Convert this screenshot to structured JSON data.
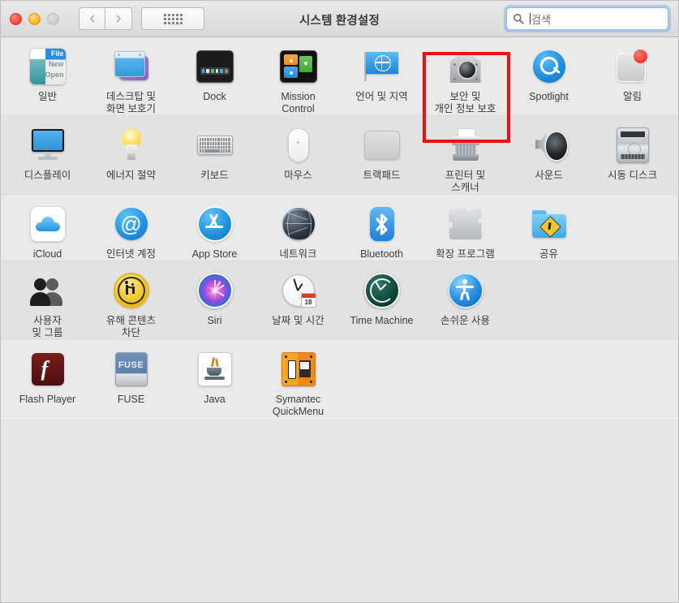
{
  "window": {
    "title": "시스템 환경설정",
    "traffic_lights": [
      "close",
      "minimize",
      "zoom"
    ],
    "nav_back": "back-chevron",
    "nav_forward": "forward-chevron",
    "show_all": "grid-icon"
  },
  "search": {
    "placeholder": "검색",
    "value": "검색",
    "icon": "search-icon"
  },
  "highlight": {
    "target": "보안 및\n개인 정보 보호",
    "color": "#ee1111"
  },
  "rows": [
    {
      "band": "band-a",
      "items": [
        {
          "label": "일반",
          "icon": "general-icon"
        },
        {
          "label": "데스크탑 및\n화면 보호기",
          "icon": "desktop-screensaver-icon"
        },
        {
          "label": "Dock",
          "icon": "dock-icon"
        },
        {
          "label": "Mission\nControl",
          "icon": "mission-control-icon"
        },
        {
          "label": "언어 및 지역",
          "icon": "language-region-icon"
        },
        {
          "label": "보안 및\n개인 정보 보호",
          "icon": "security-privacy-icon"
        },
        {
          "label": "Spotlight",
          "icon": "spotlight-icon"
        },
        {
          "label": "알림",
          "icon": "notifications-icon"
        }
      ]
    },
    {
      "band": "band-b",
      "items": [
        {
          "label": "디스플레이",
          "icon": "displays-icon"
        },
        {
          "label": "에너지 절약",
          "icon": "energy-saver-icon"
        },
        {
          "label": "키보드",
          "icon": "keyboard-icon"
        },
        {
          "label": "마우스",
          "icon": "mouse-icon"
        },
        {
          "label": "트랙패드",
          "icon": "trackpad-icon"
        },
        {
          "label": "프린터 및\n스캐너",
          "icon": "printers-scanners-icon"
        },
        {
          "label": "사운드",
          "icon": "sound-icon"
        },
        {
          "label": "시동 디스크",
          "icon": "startup-disk-icon"
        }
      ]
    },
    {
      "band": "band-a",
      "items": [
        {
          "label": "iCloud",
          "icon": "icloud-icon"
        },
        {
          "label": "인터넷 계정",
          "icon": "internet-accounts-icon"
        },
        {
          "label": "App Store",
          "icon": "app-store-icon"
        },
        {
          "label": "네트워크",
          "icon": "network-icon"
        },
        {
          "label": "Bluetooth",
          "icon": "bluetooth-icon"
        },
        {
          "label": "확장 프로그램",
          "icon": "extensions-icon"
        },
        {
          "label": "공유",
          "icon": "sharing-icon"
        }
      ]
    },
    {
      "band": "band-b",
      "items": [
        {
          "label": "사용자\n및 그룹",
          "icon": "users-groups-icon"
        },
        {
          "label": "유해 콘텐츠\n차단",
          "icon": "parental-controls-icon"
        },
        {
          "label": "Siri",
          "icon": "siri-icon"
        },
        {
          "label": "날짜 및 시간",
          "icon": "date-time-icon"
        },
        {
          "label": "Time Machine",
          "icon": "time-machine-icon"
        },
        {
          "label": "손쉬운 사용",
          "icon": "accessibility-icon"
        }
      ]
    },
    {
      "band": "band-a",
      "items": [
        {
          "label": "Flash Player",
          "icon": "flash-player-icon"
        },
        {
          "label": "FUSE",
          "icon": "fuse-icon"
        },
        {
          "label": "Java",
          "icon": "java-icon"
        },
        {
          "label": "Symantec\nQuickMenu",
          "icon": "symantec-quickmenu-icon"
        }
      ]
    }
  ],
  "icon_text": {
    "general_file": "File",
    "general_new": "New",
    "general_open": "Open",
    "fuse": "FUSE",
    "at_symbol": "@",
    "flash_f": "f",
    "calendar_day": "18"
  }
}
